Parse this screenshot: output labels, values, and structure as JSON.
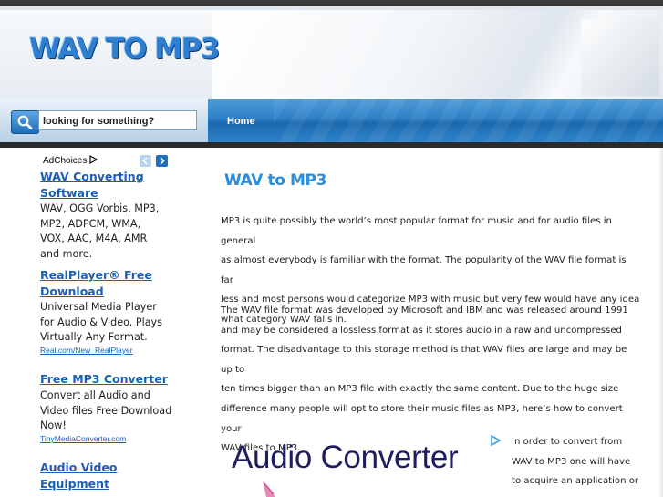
{
  "site": {
    "logo": "WAV TO MP3"
  },
  "search": {
    "placeholder": "looking for something?"
  },
  "nav": {
    "home": "Home"
  },
  "ads": {
    "adchoices_label": "AdChoices",
    "items": [
      {
        "title_line1": "WAV Converting",
        "title_line2": "Software",
        "desc": [
          "WAV, OGG Vorbis, MP3,",
          "MP2, ADPCM, WMA,",
          "VOX, AAC, M4A, AMR",
          "and more."
        ],
        "url": ""
      },
      {
        "title_line1": "RealPlayer® Free",
        "title_line2": "Download",
        "desc": [
          "Universal Media Player",
          "for Audio & Video. Plays",
          "Virtually Any Format."
        ],
        "url": "Real.com/New_RealPlayer"
      },
      {
        "title_line1": "Free MP3 Converter",
        "title_line2": "",
        "desc": [
          "Convert all Audio and",
          "Video files Free Download",
          "Now!"
        ],
        "url": "TinyMediaConverter.com"
      },
      {
        "title_line1": "Audio Video",
        "title_line2": "Equipment",
        "desc": [],
        "url": ""
      }
    ]
  },
  "article": {
    "title": "WAV to MP3",
    "para1": [
      "MP3 is quite possibly the world’s most popular format for music and for audio files in general",
      "as almost everybody is familiar with the format. The popularity of the WAV file format is far",
      "less and most persons would categorize MP3 with music but very few would have any idea",
      "what category WAV falls in."
    ],
    "para2": [
      "The WAV file format was developed by Microsoft and IBM and was released around 1991",
      "and may be considered a lossless format as it stores audio in a raw and uncompressed",
      "format. The disadvantage to this storage method is that WAV files are large and may be up to",
      "ten times bigger than an MP3 file with exactly the same content. Due to the huge size",
      "difference many people will opt to store their music files as MP3, here’s how to convert your",
      "WAV files to MP3."
    ],
    "banner_text": "Audio Converter",
    "para3": [
      "In order to convert from",
      "WAV to MP3 one will have",
      "to acquire an application or"
    ]
  },
  "colors": {
    "link": "#1a5fb4",
    "title": "#2b8ddb",
    "nav_blue": "#2d7fc6"
  }
}
